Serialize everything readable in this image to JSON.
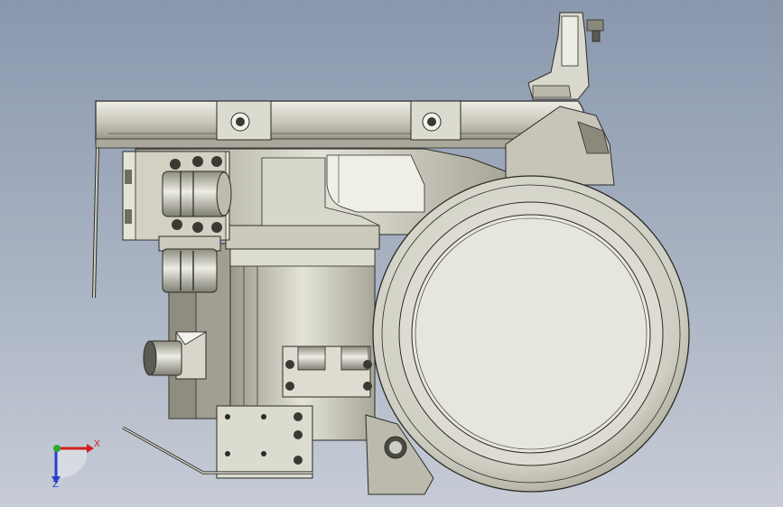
{
  "viewport": {
    "background_top": "#8a97ad",
    "background_bottom": "#c7ccd6"
  },
  "triad": {
    "x_label": "X",
    "y_label": "Y",
    "z_label": "Z",
    "x_color": "#d21e1e",
    "y_color": "#2fa82f",
    "z_color": "#2a3dc8"
  },
  "colors": {
    "metal_light": "#e2e1d6",
    "metal_mid": "#bdbcae",
    "metal_dark": "#8e8d80",
    "edge": "#2b2b26"
  }
}
